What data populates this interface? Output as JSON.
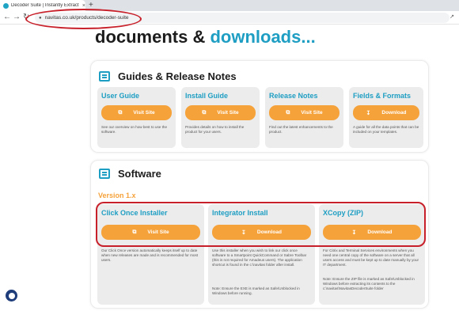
{
  "browser": {
    "tab_title": "Decoder Suite | Instantly Extract",
    "tab_close": "×",
    "new_tab": "+",
    "back": "←",
    "forward": "→",
    "reload": "↻",
    "url": "navitas.co.uk/products/decoder-suite"
  },
  "page": {
    "heading_dark": "documents & ",
    "heading_accent": "downloads..."
  },
  "guides": {
    "title": "Guides & Release Notes",
    "cards": [
      {
        "title": "User Guide",
        "button": "Visit Site",
        "icon": "external-link-icon",
        "desc": "See our overview on how best to use the software."
      },
      {
        "title": "Install Guide",
        "button": "Visit Site",
        "icon": "external-link-icon",
        "desc": "Provides details on how to install the product for your users."
      },
      {
        "title": "Release Notes",
        "button": "Visit Site",
        "icon": "external-link-icon",
        "desc": "Find out the latest enhancements to the product."
      },
      {
        "title": "Fields & Formats",
        "button": "Download",
        "icon": "download-icon",
        "desc": "A guide for all the data points that can be included on your templates."
      }
    ]
  },
  "software": {
    "title": "Software",
    "version": "Version 1.x",
    "cards": [
      {
        "title": "Click Once Installer",
        "button": "Visit Site",
        "icon": "external-link-icon",
        "desc": "Our Click Once version automatically keeps itself up to date when new releases are made and is recommended for most users."
      },
      {
        "title": "Integrator Install",
        "button": "Download",
        "icon": "download-icon",
        "desc": "Use this installer when you wish to link our click once software to a Smartpoint QuickCommand or Sabre Toolbar (this is not required for Amadeus users). The application shortcut is found in the c:\\navitas folder after install.",
        "note": "Note: Ensure the EXE is marked as Safe/Unblocked in Windows before running."
      },
      {
        "title": "XCopy (ZIP)",
        "button": "Download",
        "icon": "download-icon",
        "desc": "For Citrix and Terminal Services environments when you need one central copy of the software on a server that all users access and must be kept up to date manually by your IT department.",
        "note": "Note: Ensure the ZIP file is marked as Safe/Unblocked in Windows before extracting its contents to the c:\\navitas\\NavitasDecoderSuite folder"
      }
    ]
  },
  "colors": {
    "accent": "#1e9ec3",
    "button": "#f5a23a",
    "highlight": "#c8202a",
    "card_bg": "#ececec"
  }
}
